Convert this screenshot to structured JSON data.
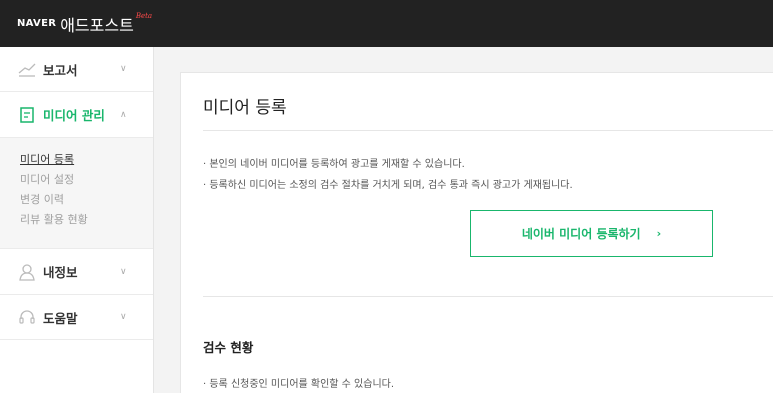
{
  "header": {
    "naver": "NAVER",
    "service": "애드포스트",
    "beta": "Beta"
  },
  "sidebar": {
    "menus": [
      {
        "label": "보고서",
        "icon": "chart-line-icon"
      },
      {
        "label": "미디어 관리",
        "icon": "document-icon"
      },
      {
        "label": "내정보",
        "icon": "user-icon"
      },
      {
        "label": "도움말",
        "icon": "headset-icon"
      }
    ],
    "submenu": [
      "미디어 등록",
      "미디어 설정",
      "변경 이력",
      "리뷰 활용 현황"
    ],
    "active_submenu": "미디어 등록"
  },
  "main": {
    "title": "미디어 등록",
    "bullets": [
      "본인의 네이버 미디어를 등록하여 광고를 게재할 수 있습니다.",
      "등록하신 미디어는 소정의 검수 절차를 거치게 되며, 검수 통과 즉시 광고가 게재됩니다."
    ],
    "register_button": "네이버 미디어 등록하기",
    "review_title": "검수 현황",
    "review_bullets": [
      "등록 신청중인 미디어를 확인할 수 있습니다."
    ]
  },
  "colors": {
    "accent": "#19b66c",
    "header_bg": "#222222"
  }
}
